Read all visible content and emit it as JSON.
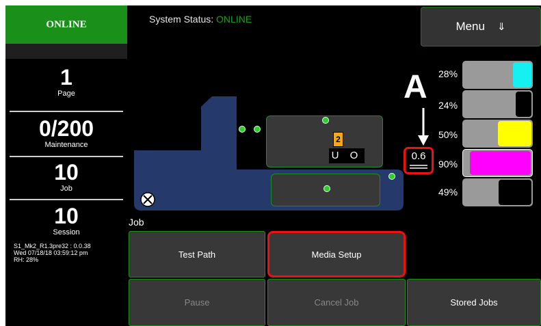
{
  "status_indicator": {
    "label": "ONLINE"
  },
  "header": {
    "system_status_label": "System Status:",
    "system_status_value": "ONLINE"
  },
  "menu": {
    "label": "Menu",
    "icon": "double-arrow-down-icon",
    "arrow_glyph": "⇓"
  },
  "counters": [
    {
      "value": "1",
      "label": "Page"
    },
    {
      "value": "0/200",
      "label": "Maintenance"
    },
    {
      "value": "10",
      "label": "Job"
    },
    {
      "value": "10",
      "label": "Session"
    }
  ],
  "system_info": {
    "line1": "S1_Mk2_R1.3pre32 : 0.0.38",
    "line2": "Wed 07/18/18 03:59:12 pm",
    "line3": "RH: 28%"
  },
  "diagram": {
    "job_label": "Job",
    "bin_number": "2",
    "slot_text": "U O"
  },
  "annotation": {
    "letter": "A",
    "gauge_value": "0.6",
    "highlight_color": "#e11111"
  },
  "inks": [
    {
      "percent": "28%",
      "level": 0.28,
      "color": "#17f0f0",
      "selected": false
    },
    {
      "percent": "24%",
      "level": 0.24,
      "color": "#000000",
      "selected": false
    },
    {
      "percent": "50%",
      "level": 0.5,
      "color": "#ffff00",
      "selected": false
    },
    {
      "percent": "90%",
      "level": 0.9,
      "color": "#ff00ff",
      "selected": true
    },
    {
      "percent": "49%",
      "level": 0.49,
      "color": "#000000",
      "selected": false
    }
  ],
  "buttons": {
    "test_path": "Test Path",
    "media_setup": "Media Setup",
    "pause": "Pause",
    "cancel_job": "Cancel Job",
    "stored_jobs": "Stored Jobs"
  },
  "colors": {
    "online_green": "#1a8f1a",
    "machine_blue": "#253a6b",
    "panel_gray": "#383838"
  }
}
